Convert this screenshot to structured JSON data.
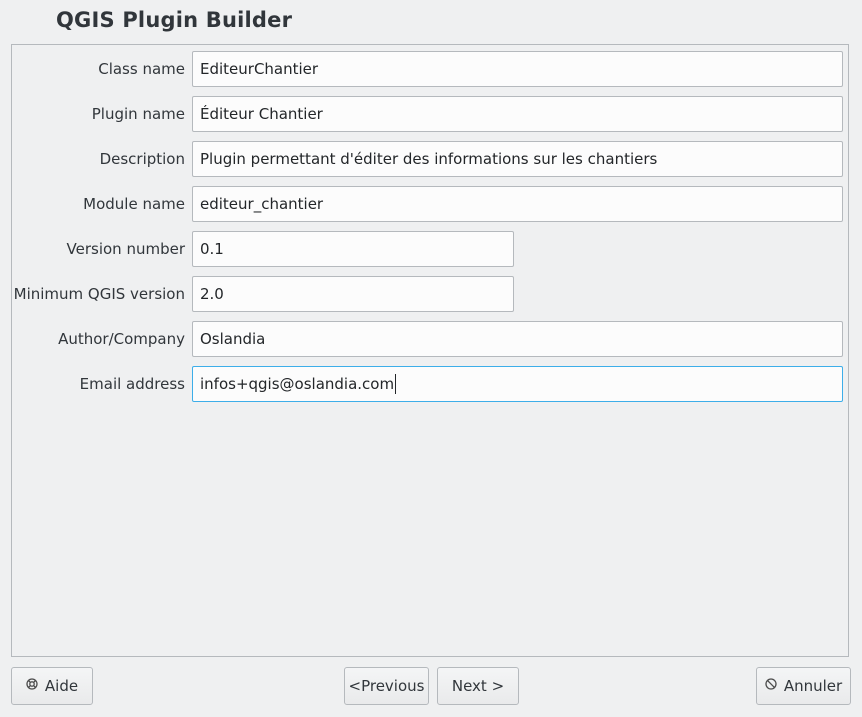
{
  "window": {
    "title": "QGIS Plugin Builder"
  },
  "form": {
    "fields": [
      {
        "label": "Class name",
        "value": "EditeurChantier"
      },
      {
        "label": "Plugin name",
        "value": "Éditeur Chantier"
      },
      {
        "label": "Description",
        "value": "Plugin permettant d'éditer des informations sur les chantiers"
      },
      {
        "label": "Module name",
        "value": "editeur_chantier"
      },
      {
        "label": "Version number",
        "value": "0.1"
      },
      {
        "label": "Minimum QGIS version",
        "value": "2.0"
      },
      {
        "label": "Author/Company",
        "value": "Oslandia"
      },
      {
        "label": "Email address",
        "value": "infos+qgis@oslandia.com"
      }
    ]
  },
  "buttons": {
    "help": {
      "label": "Aide",
      "icon": "lifebuoy-icon"
    },
    "previous": {
      "label": "<Previous"
    },
    "next": {
      "label": "Next >"
    },
    "cancel": {
      "label": "Annuler",
      "icon": "cancel-icon"
    }
  },
  "colors": {
    "background": "#eff0f1",
    "focus": "#3daee9",
    "field_bg": "#fcfcfc",
    "border": "#b5b9bd"
  }
}
